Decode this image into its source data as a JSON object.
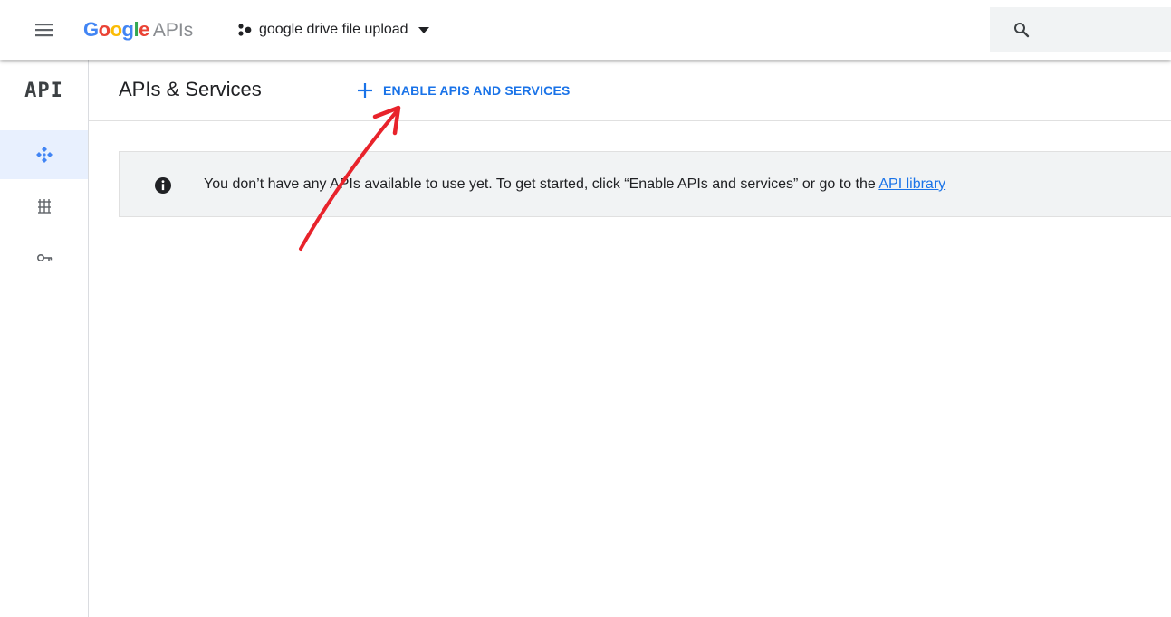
{
  "topbar": {
    "logo_letters": [
      "G",
      "o",
      "o",
      "g",
      "l",
      "e"
    ],
    "logo_suffix": "APIs",
    "project_name": "google drive file upload"
  },
  "rail": {
    "logo_text": "API",
    "items": [
      {
        "icon": "api-dashboard-icon",
        "active": true
      },
      {
        "icon": "library-icon",
        "active": false
      },
      {
        "icon": "key-icon",
        "active": false
      }
    ]
  },
  "header": {
    "title": "APIs & Services",
    "enable_button_label": "ENABLE APIS AND SERVICES"
  },
  "banner": {
    "message": "You don’t have any APIs available to use yet. To get started, click “Enable APIs and services” or go to the ",
    "link_text": "API library"
  },
  "colors": {
    "accent": "#1a73e8",
    "active_rail": "#e8f0fe",
    "banner_bg": "#f1f3f4",
    "annotation_arrow": "#e8232b"
  },
  "logo_colors": [
    "#4285F4",
    "#EA4335",
    "#FBBC05",
    "#4285F4",
    "#34A853",
    "#EA4335"
  ]
}
